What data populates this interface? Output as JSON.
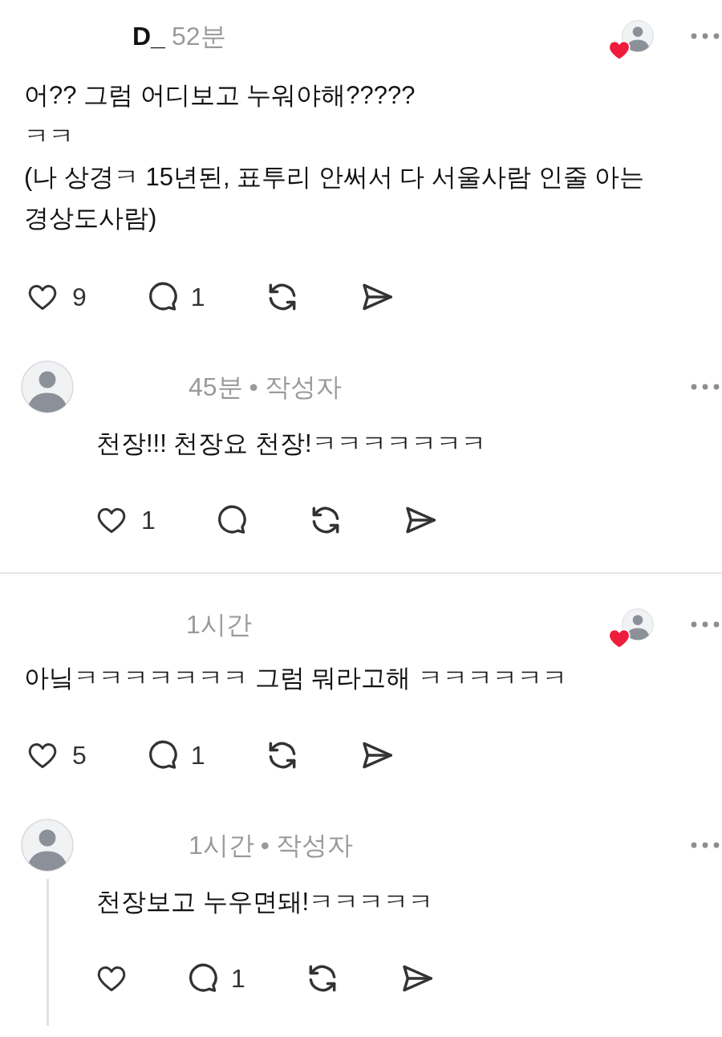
{
  "posts": [
    {
      "username": "D_",
      "time": "52분",
      "liked_by_author": true,
      "lines": [
        "어?? 그럼 어디보고 누워야해?????",
        "ㅋㅋ",
        "(나 상경ㅋ 15년된, 표투리 안써서 다 서울사람 인줄 아는 경상도사람)"
      ],
      "like_count": "9",
      "reply_count": "1",
      "replies": [
        {
          "time": "45분",
          "separator": "•",
          "badge": "작성자",
          "text": "천장!!! 천장요 천장!ㅋㅋㅋㅋㅋㅋㅋ",
          "like_count": "1",
          "thread_line": false
        }
      ]
    },
    {
      "time": "1시간",
      "liked_by_author": true,
      "lines": [
        "아닠ㅋㅋㅋㅋㅋㅋㅋ 그럼 뭐라고해 ㅋㅋㅋㅋㅋㅋ"
      ],
      "like_count": "5",
      "reply_count": "1",
      "replies": [
        {
          "time": "1시간",
          "separator": "•",
          "badge": "작성자",
          "text": "천장보고 누우면돼!ㅋㅋㅋㅋㅋ",
          "reply_count": "1",
          "thread_line": true
        }
      ]
    }
  ]
}
